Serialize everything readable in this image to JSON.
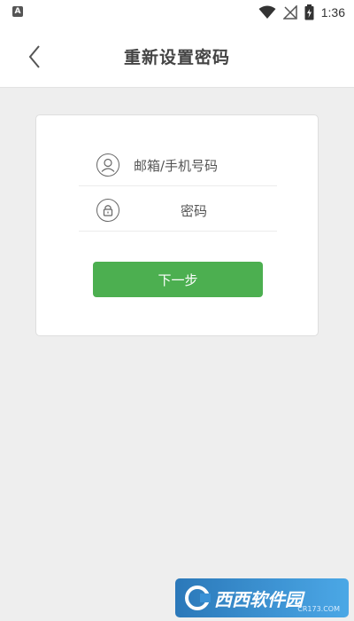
{
  "status_bar": {
    "app_icon_letter": "A",
    "time": "1:36"
  },
  "header": {
    "title": "重新设置密码"
  },
  "form": {
    "account_placeholder": "邮箱/手机号码",
    "account_value": "",
    "password_placeholder": "密码",
    "password_value": "",
    "next_label": "下一步"
  },
  "watermark": {
    "brand": "西西软件园",
    "url": "CR173.COM"
  },
  "colors": {
    "accent": "#4caf50",
    "background": "#eeeeee"
  }
}
